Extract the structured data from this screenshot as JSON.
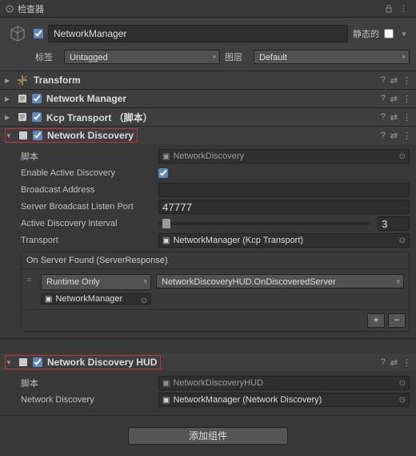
{
  "titlebar": {
    "title": "检查器"
  },
  "header": {
    "name": "NetworkManager",
    "static_label": "静态的",
    "tag_label": "标签",
    "tag_value": "Untagged",
    "layer_label": "图层",
    "layer_value": "Default"
  },
  "components": [
    {
      "title": "Transform",
      "collapsed": true,
      "checkbox": false,
      "icon": "transform"
    },
    {
      "title": "Network Manager",
      "collapsed": true,
      "checkbox": true,
      "icon": "script"
    },
    {
      "title": "Kcp Transport  （脚本）",
      "collapsed": true,
      "checkbox": true,
      "icon": "script"
    }
  ],
  "nd": {
    "title": "Network Discovery",
    "script_label": "脚本",
    "script_value": "NetworkDiscovery",
    "enable_label": "Enable Active Discovery",
    "enable_value": true,
    "addr_label": "Broadcast Address",
    "addr_value": "",
    "port_label": "Server Broadcast Listen Port",
    "port_value": "47777",
    "interval_label": "Active Discovery Interval",
    "interval_value": "3",
    "transport_label": "Transport",
    "transport_value": "NetworkManager (Kcp Transport)",
    "event_title": "On Server Found (ServerResponse)",
    "runtime_label": "Runtime Only",
    "callback_value": "NetworkDiscoveryHUD.OnDiscoveredServer",
    "target_value": "NetworkManager"
  },
  "ndhud": {
    "title": "Network Discovery HUD",
    "script_label": "脚本",
    "script_value": "NetworkDiscoveryHUD",
    "nd_label": "Network Discovery",
    "nd_value": "NetworkManager (Network Discovery)"
  },
  "add_component": "添加组件"
}
